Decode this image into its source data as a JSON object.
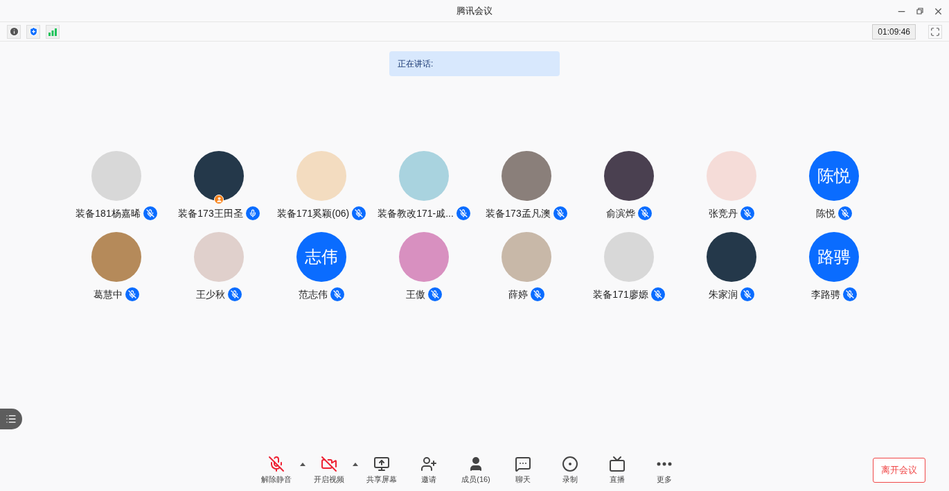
{
  "window": {
    "title": "腾讯会议"
  },
  "timer": "01:09:46",
  "speaking": {
    "label": "正在讲话:"
  },
  "participants": [
    {
      "name": "装备181杨嘉晞",
      "kind": "photo",
      "muted": true,
      "host": false
    },
    {
      "name": "装备173王田圣",
      "kind": "photo",
      "muted": false,
      "host": true
    },
    {
      "name": "装备171奚颖(06)",
      "kind": "photo",
      "muted": true,
      "host": false
    },
    {
      "name": "装备教改171-戚...",
      "kind": "photo",
      "muted": true,
      "host": false
    },
    {
      "name": "装备173孟凡澳",
      "kind": "photo",
      "muted": true,
      "host": false
    },
    {
      "name": "俞滨烨",
      "kind": "photo",
      "muted": true,
      "host": false
    },
    {
      "name": "张竞丹",
      "kind": "photo",
      "muted": true,
      "host": false
    },
    {
      "name": "陈悦",
      "kind": "initials",
      "initials": "陈悦",
      "muted": true,
      "host": false
    },
    {
      "name": "葛慧中",
      "kind": "photo",
      "muted": true,
      "host": false
    },
    {
      "name": "王少秋",
      "kind": "photo",
      "muted": true,
      "host": false
    },
    {
      "name": "范志伟",
      "kind": "initials",
      "initials": "志伟",
      "muted": true,
      "host": false
    },
    {
      "name": "王傲",
      "kind": "photo",
      "muted": true,
      "host": false
    },
    {
      "name": "薛婷",
      "kind": "photo",
      "muted": true,
      "host": false
    },
    {
      "name": "装备171廖嫄",
      "kind": "photo",
      "muted": true,
      "host": false
    },
    {
      "name": "朱家润",
      "kind": "photo",
      "muted": true,
      "host": false
    },
    {
      "name": "李路骋",
      "kind": "initials",
      "initials": "路骋",
      "muted": true,
      "host": false
    }
  ],
  "toolbar": [
    {
      "kind": "mic",
      "label": "解除静音",
      "on": false,
      "has_menu": true
    },
    {
      "kind": "video",
      "label": "开启视频",
      "on": false,
      "has_menu": true
    },
    {
      "kind": "share",
      "label": "共享屏幕"
    },
    {
      "kind": "invite",
      "label": "邀请"
    },
    {
      "kind": "members",
      "label": "成员(16)"
    },
    {
      "kind": "chat",
      "label": "聊天"
    },
    {
      "kind": "record",
      "label": "录制"
    },
    {
      "kind": "live",
      "label": "直播"
    },
    {
      "kind": "more",
      "label": "更多"
    }
  ],
  "leave_button": "离开会议"
}
